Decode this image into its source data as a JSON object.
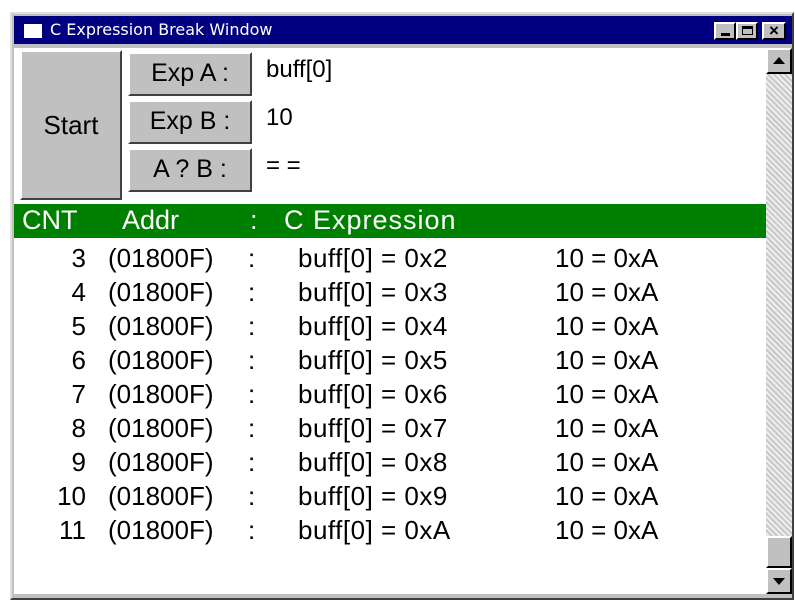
{
  "window": {
    "title": "C Expression Break Window"
  },
  "controls": {
    "start_label": "Start",
    "exp_a_label": "Exp A :",
    "exp_a_value": "buff[0]",
    "exp_b_label": "Exp B :",
    "exp_b_value": "10",
    "op_label": "A ? B :",
    "op_value": "= ="
  },
  "list": {
    "columns": [
      "CNT",
      "Addr",
      ":",
      "C Expression"
    ],
    "rows": [
      {
        "cnt": "3",
        "addr": "(01800F)",
        "sep": ":",
        "exp_a": "buff[0] = 0x2",
        "exp_b": "10 = 0xA"
      },
      {
        "cnt": "4",
        "addr": "(01800F)",
        "sep": ":",
        "exp_a": "buff[0] = 0x3",
        "exp_b": "10 = 0xA"
      },
      {
        "cnt": "5",
        "addr": "(01800F)",
        "sep": ":",
        "exp_a": "buff[0] = 0x4",
        "exp_b": "10 = 0xA"
      },
      {
        "cnt": "6",
        "addr": "(01800F)",
        "sep": ":",
        "exp_a": "buff[0] = 0x5",
        "exp_b": "10 = 0xA"
      },
      {
        "cnt": "7",
        "addr": "(01800F)",
        "sep": ":",
        "exp_a": "buff[0] = 0x6",
        "exp_b": "10 = 0xA"
      },
      {
        "cnt": "8",
        "addr": "(01800F)",
        "sep": ":",
        "exp_a": "buff[0] = 0x7",
        "exp_b": "10 = 0xA"
      },
      {
        "cnt": "9",
        "addr": "(01800F)",
        "sep": ":",
        "exp_a": "buff[0] = 0x8",
        "exp_b": "10 = 0xA"
      },
      {
        "cnt": "10",
        "addr": "(01800F)",
        "sep": ":",
        "exp_a": "buff[0] = 0x9",
        "exp_b": "10 = 0xA"
      },
      {
        "cnt": "11",
        "addr": "(01800F)",
        "sep": ":",
        "exp_a": "buff[0] = 0xA",
        "exp_b": "10 = 0xA"
      }
    ]
  },
  "colors": {
    "title_bar": "#000080",
    "list_header": "#008000",
    "face": "#c0c0c0"
  },
  "icons": {
    "window": "app-icon",
    "minimize": "minimize-icon",
    "maximize": "maximize-icon",
    "close": "close-icon",
    "scroll_up": "arrow-up-icon",
    "scroll_down": "arrow-down-icon"
  }
}
